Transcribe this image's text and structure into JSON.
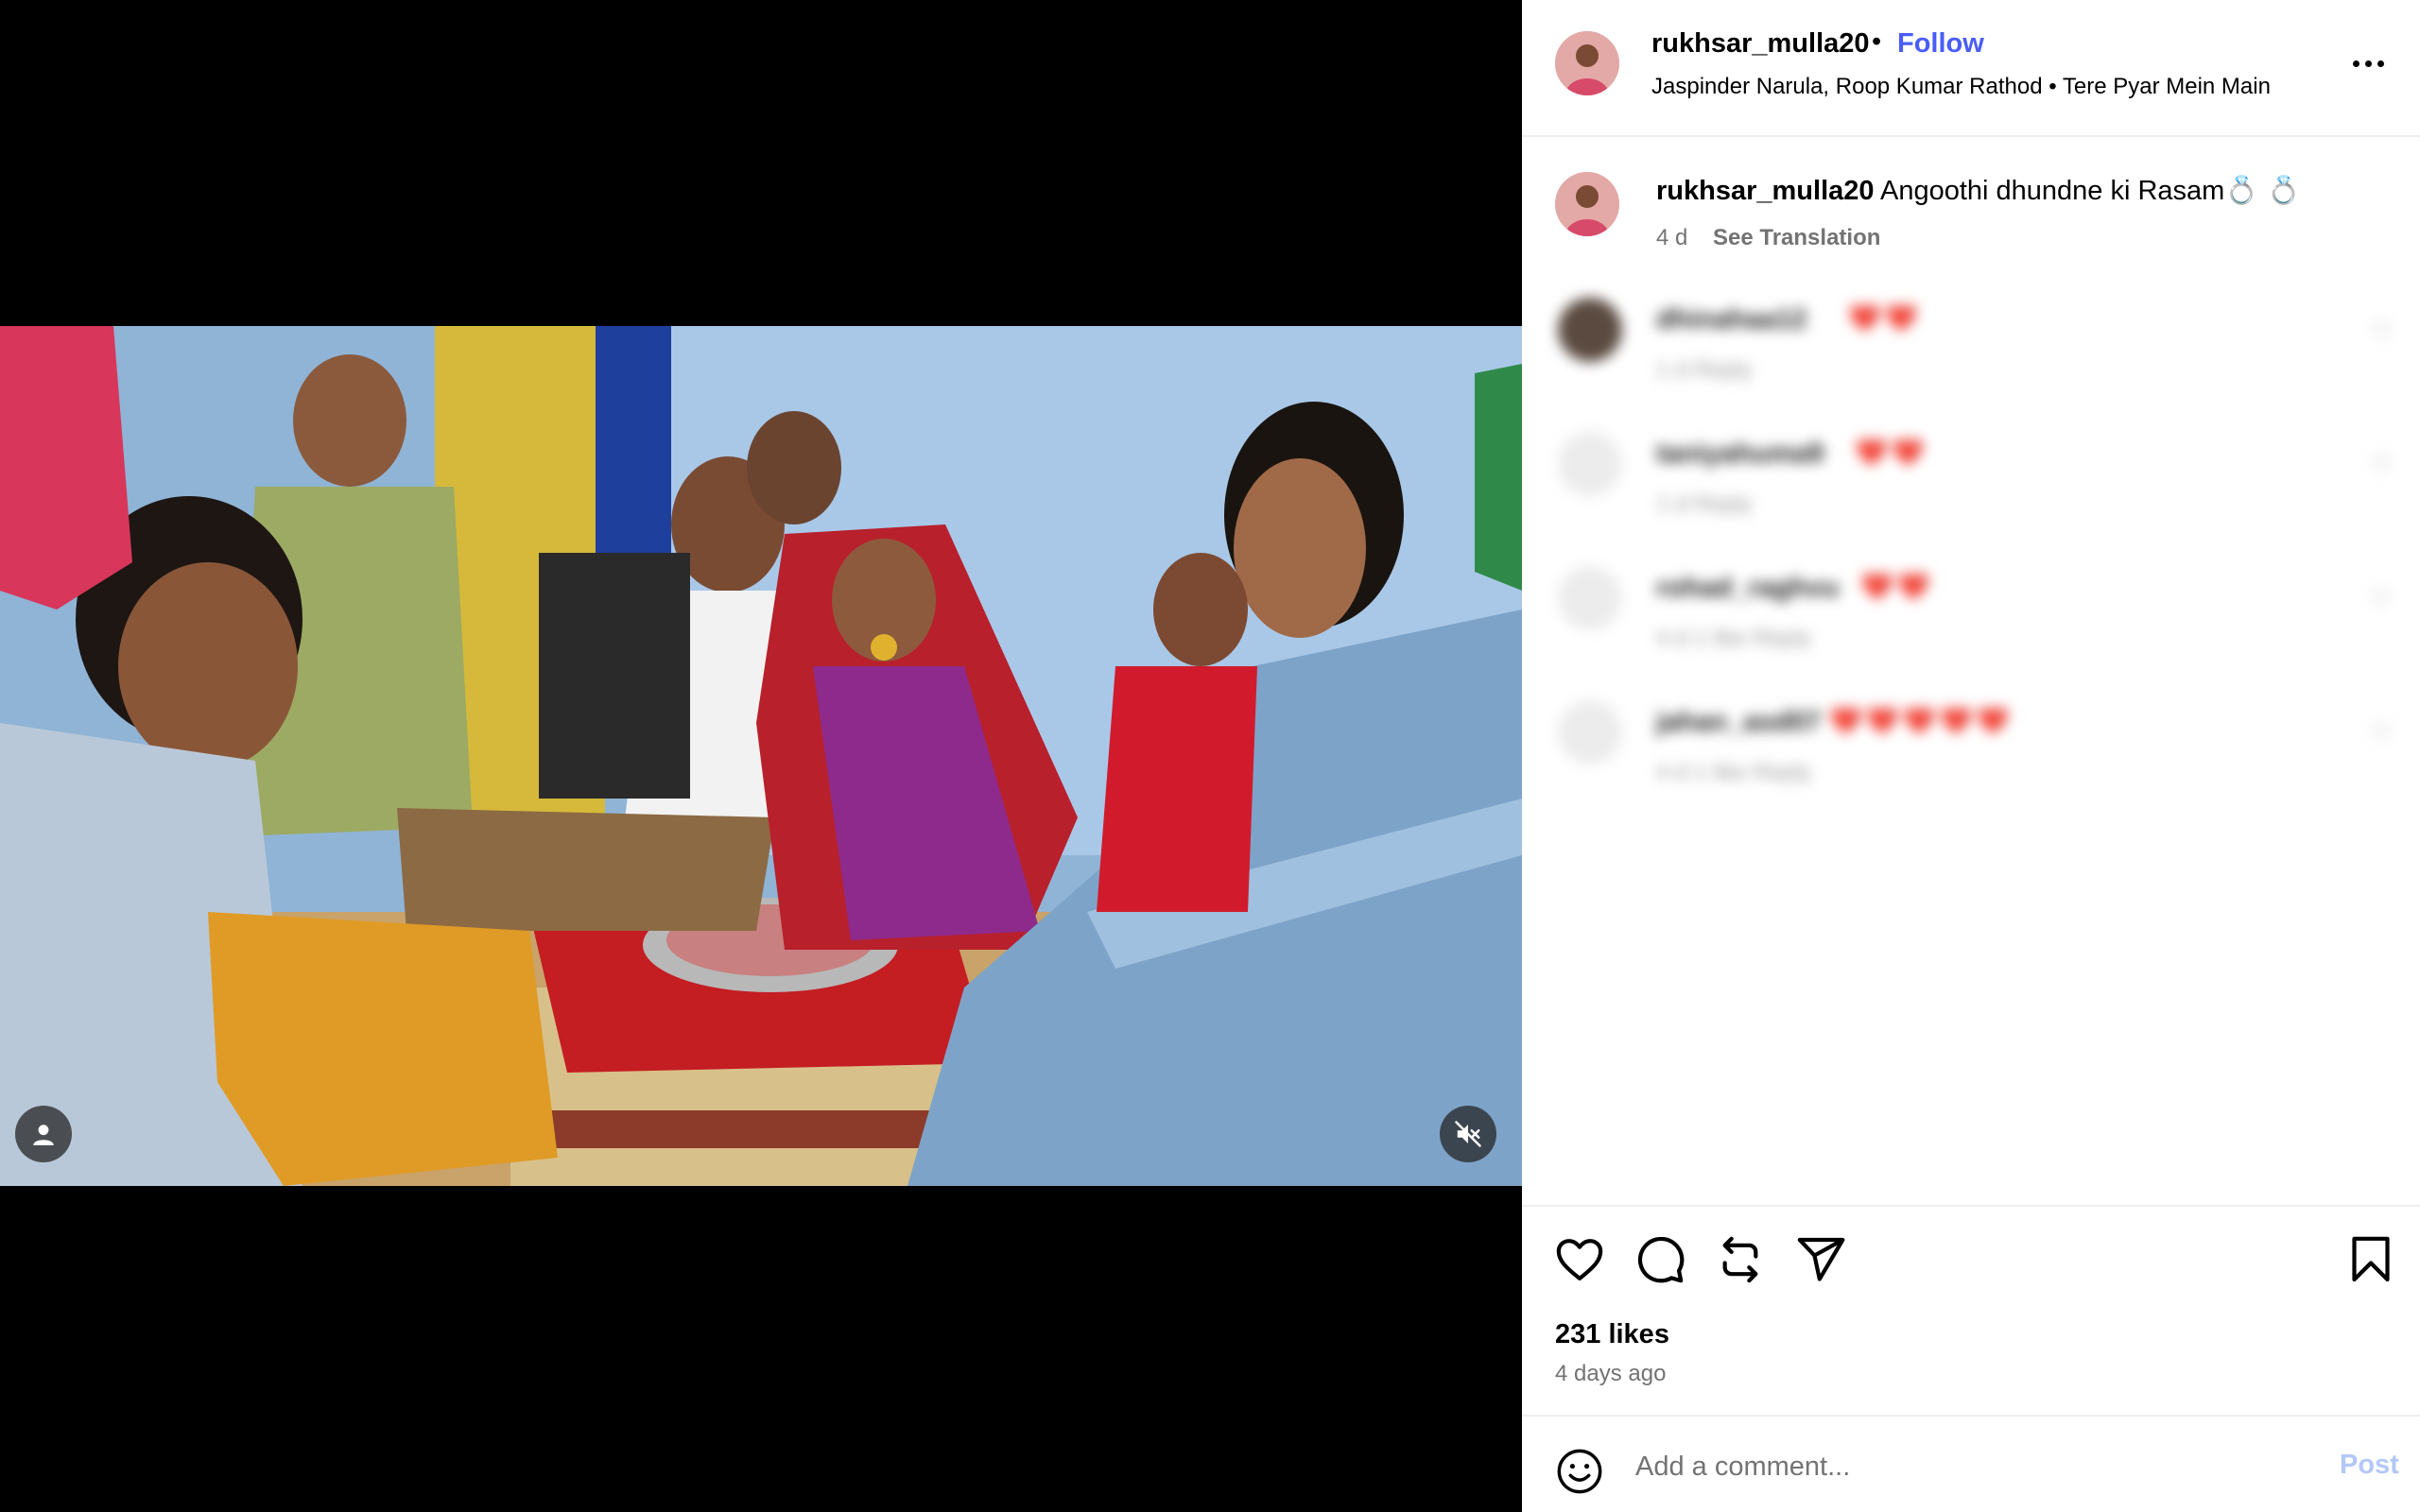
{
  "post": {
    "username": "rukhsar_mulla20",
    "separator": "•",
    "follow_label": "Follow",
    "audio": "Jaspinder Narula, Roop Kumar Rathod • Tere Pyar Mein Main",
    "more_icon": "more-options-icon"
  },
  "caption": {
    "username": "rukhsar_mulla20",
    "text": " Angoothi dhundne ki Rasam💍 💍",
    "time": "4 d",
    "translate_label": "See Translation"
  },
  "comments": [
    {
      "username": "dhinahaa12",
      "hearts": "❤️❤️",
      "meta": "1 d   Reply"
    },
    {
      "username": "taniyahuma9",
      "hearts": "❤️❤️",
      "meta": "1 d   Reply"
    },
    {
      "username": "rohad_raghvu",
      "hearts": "❤️❤️",
      "meta": "4 d   1 like   Reply"
    },
    {
      "username": "jahan_asd07",
      "hearts": "❤️❤️❤️❤️❤️",
      "meta": "4 d   1 like   Reply"
    }
  ],
  "actions": {
    "like_icon": "heart-icon",
    "comment_icon": "comment-icon",
    "share_icon": "repost-icon",
    "send_icon": "send-icon",
    "save_icon": "bookmark-icon"
  },
  "likes_label": "231 likes",
  "date_label": "4 days ago",
  "comment_box": {
    "placeholder": "Add a comment...",
    "post_label": "Post"
  },
  "colors": {
    "accent": "#4a5df9",
    "post_disabled": "#b3c7f7",
    "secondary_text": "#737373"
  }
}
